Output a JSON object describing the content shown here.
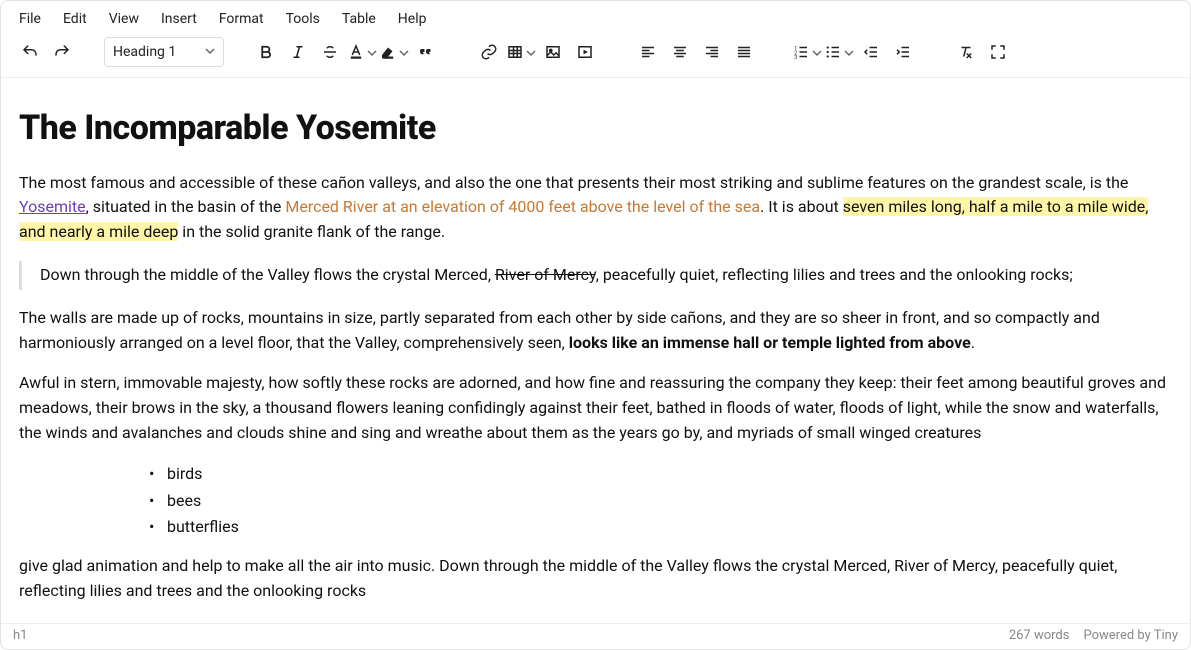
{
  "menubar": [
    "File",
    "Edit",
    "View",
    "Insert",
    "Format",
    "Tools",
    "Table",
    "Help"
  ],
  "toolbar": {
    "block_format": "Heading 1"
  },
  "doc": {
    "title": "The Incomparable Yosemite",
    "p1a": "The most famous and accessible of these cañon valleys, and also the one that presents their most striking and sublime features on the grandest scale, is the ",
    "p1_link": "Yosemite",
    "p1b": ", situated in the basin of the ",
    "p1_colored": "Merced River at an elevation of 4000 feet above the level of the sea",
    "p1c": ". It is about ",
    "p1_hl1": "seven miles long, half a mile to a mile wide, ",
    "p1_hl2": "and nearly a mile deep",
    "p1d": " in the solid granite flank of the range.",
    "q_a": "Down through the middle of the Valley flows the crystal Merced, ",
    "q_strike": "River of Mercy",
    "q_b": ", peacefully quiet, reflecting lilies and trees and the onlooking rocks;",
    "p2a": "The walls are made up of rocks, mountains in size, partly separated from each other by side cañons, and they are so sheer in front, and so compactly and harmoniously arranged on a level floor, that the Valley, comprehensively seen, ",
    "p2_bold": "looks like an immense hall or temple lighted from above",
    "p2b": ".",
    "p3": "Awful in stern, immovable majesty, how softly these rocks are adorned, and how fine and reassuring the company they keep: their feet among beautiful groves and meadows, their brows in the sky, a thousand flowers leaning confidingly against their feet, bathed in floods of water, floods of light, while the snow and waterfalls, the winds and avalanches and clouds shine and sing and wreathe about them as the years go by, and myriads of small winged creatures",
    "list": [
      "birds",
      "bees",
      "butterflies"
    ],
    "p4": "give glad animation and help to make all the air into music. Down through the middle of the Valley flows the crystal Merced, River of Mercy, peacefully quiet, reflecting lilies and trees and the onlooking rocks"
  },
  "status": {
    "path": "h1",
    "words": "267 words",
    "branding": "Powered by Tiny"
  }
}
